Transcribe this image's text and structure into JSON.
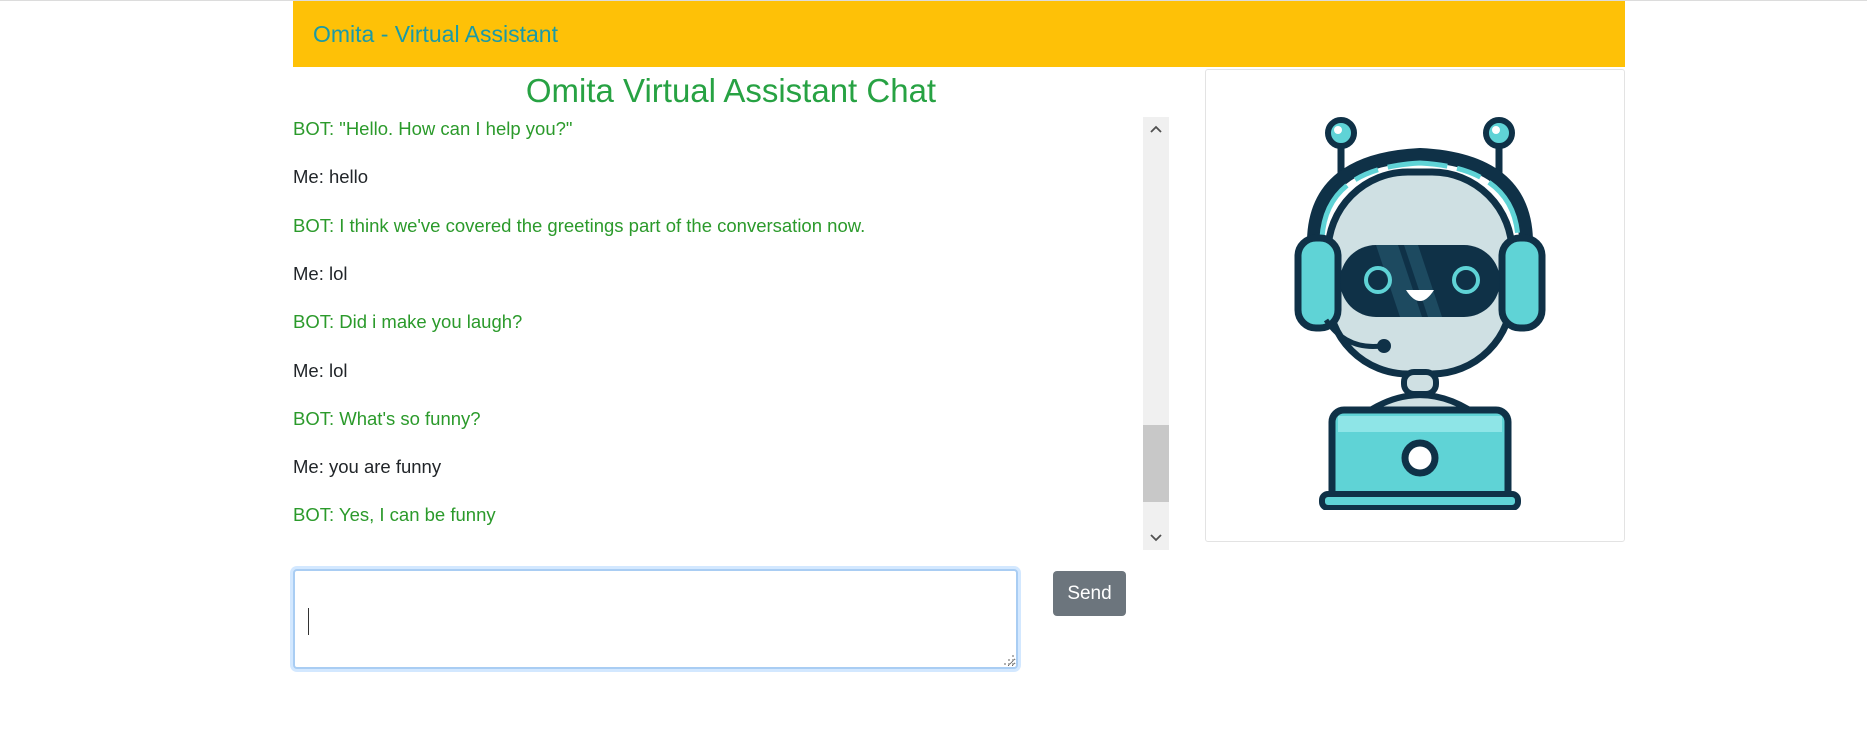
{
  "navbar": {
    "brand": "Omita - Virtual Assistant"
  },
  "chat": {
    "title": "Omita Virtual Assistant Chat",
    "messages": [
      {
        "sender": "bot",
        "text": "BOT: \"Hello. How can I help you?\""
      },
      {
        "sender": "me",
        "text": "Me: hello"
      },
      {
        "sender": "bot",
        "text": "BOT: I think we've covered the greetings part of the conversation now."
      },
      {
        "sender": "me",
        "text": "Me: lol"
      },
      {
        "sender": "bot",
        "text": "BOT: Did i make you laugh?"
      },
      {
        "sender": "me",
        "text": "Me: lol"
      },
      {
        "sender": "bot",
        "text": "BOT: What's so funny?"
      },
      {
        "sender": "me",
        "text": "Me: you are funny"
      },
      {
        "sender": "bot",
        "text": "BOT: Yes, I can be funny"
      }
    ],
    "input_value": "",
    "send_label": "Send"
  },
  "icons": {
    "scroll_up": "chevron-up-icon",
    "scroll_down": "chevron-down-icon",
    "bot_image": "robot-headset-laptop-icon"
  },
  "colors": {
    "navbar_bg": "#fec107",
    "brand_text": "#1a9aa7",
    "title_text": "#27a243",
    "bot_text": "#2b9a2b",
    "me_text": "#212529",
    "send_bg": "#6c757d",
    "robot_teal": "#5fd3d6",
    "robot_dark": "#0f3147",
    "robot_grey": "#cfe0e3"
  }
}
